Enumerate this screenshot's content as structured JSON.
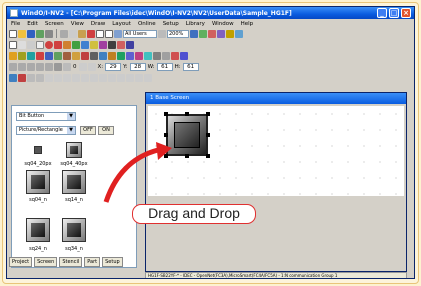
{
  "window": {
    "title": "WindO/I-NV2 - [C:\\Program Files\\idec\\WindO\\I-NV2\\NV2\\UserData\\Sample_HG1F]"
  },
  "menu": [
    "File",
    "Edit",
    "Screen",
    "View",
    "Draw",
    "Layout",
    "Online",
    "Setup",
    "Library",
    "Window",
    "Help"
  ],
  "toolbar": {
    "layer_combo": "All Users",
    "zoom": "200%",
    "x_label": "X:",
    "x_value": "29",
    "y_label": "Y:",
    "y_value": "28",
    "w_label": "W:",
    "w_value": "61",
    "h_label": "H:",
    "h_value": "61",
    "field_b": "0"
  },
  "parts_panel": {
    "category": "Bit Button",
    "shape": "Picture/Rectangle",
    "off_label": "OFF",
    "on_label": "ON",
    "items": [
      "sq04_20px",
      "sq04_40px",
      "sq04_n",
      "sq14_n",
      "sq24_n",
      "sq34_n"
    ]
  },
  "tabs": [
    "Project",
    "Screen",
    "Stencil",
    "Part",
    "Setup"
  ],
  "screen": {
    "title": "1 Base Screen"
  },
  "status": "HG1F-SB22YF-* - IDEC - OpenNet(FC3A),MicroSmart(FC4A/FC5A) - 1:N communication  Group 1",
  "callout": "Drag and Drop"
}
